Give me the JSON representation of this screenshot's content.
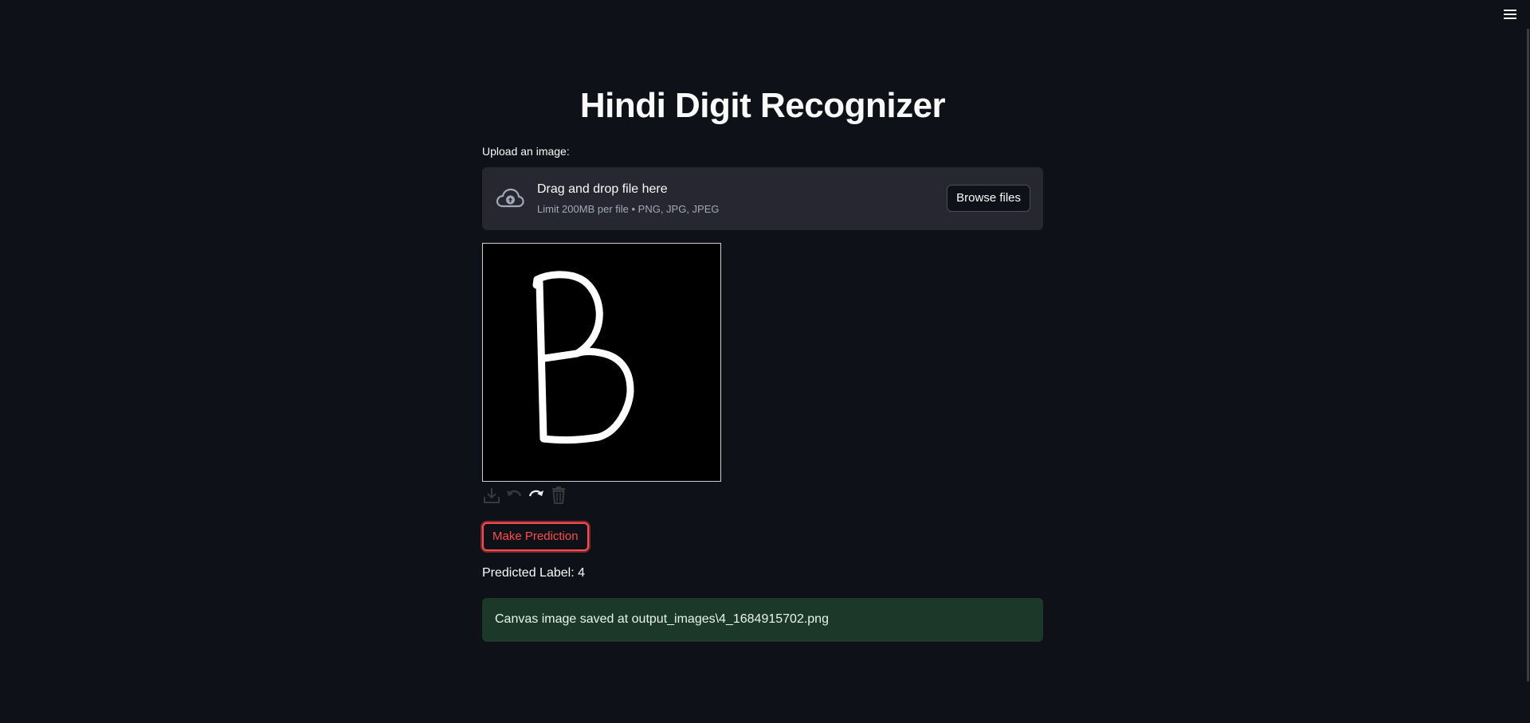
{
  "app": {
    "title": "Hindi Digit Recognizer"
  },
  "uploader": {
    "label": "Upload an image:",
    "drop_title": "Drag and drop file here",
    "drop_limit": "Limit 200MB per file • PNG, JPG, JPEG",
    "browse_label": "Browse files",
    "icon": "cloud-upload-icon"
  },
  "canvas": {
    "drawn_character": "B",
    "background": "#000000",
    "stroke_color": "#ffffff",
    "toolbar": [
      {
        "name": "download-icon"
      },
      {
        "name": "undo-icon"
      },
      {
        "name": "redo-icon"
      },
      {
        "name": "trash-icon"
      }
    ]
  },
  "actions": {
    "predict_label": "Make Prediction"
  },
  "result": {
    "predicted_text": "Predicted Label: 4",
    "saved_message": "Canvas image saved at output_images\\4_1684915702.png"
  },
  "colors": {
    "background": "#0e1117",
    "accent": "#ff4b4b",
    "success_bg": "#1c3829",
    "panel": "#262730"
  }
}
